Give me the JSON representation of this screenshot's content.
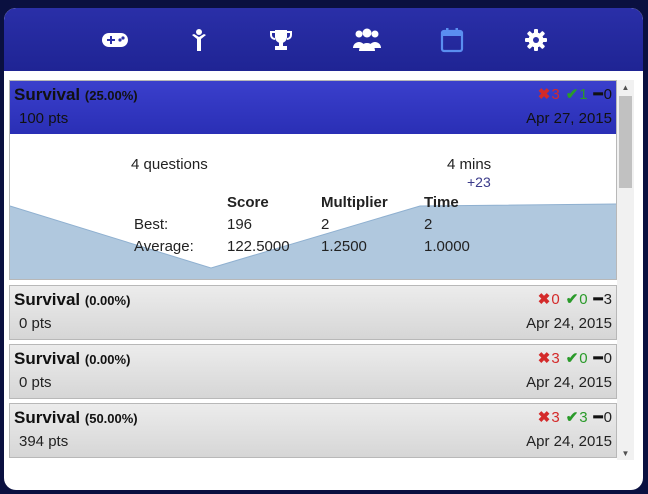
{
  "nav": {
    "icons": [
      "gamepad-icon",
      "person-icon",
      "trophy-icon",
      "users-icon",
      "calendar-icon",
      "gear-icon"
    ],
    "active_index": 4
  },
  "games": [
    {
      "mode": "Survival",
      "percent": "(25.00%)",
      "points": "100 pts",
      "wrong": "3",
      "right": "1",
      "skipped": "0",
      "date": "Apr 27, 2015",
      "expanded": true,
      "detail": {
        "questions": "4 questions",
        "time": "4 mins",
        "time_delta": "+23",
        "columns": [
          "Score",
          "Multiplier",
          "Time"
        ],
        "rows": [
          {
            "label": "Best:",
            "values": [
              "196",
              "2",
              "2"
            ]
          },
          {
            "label": "Average:",
            "values": [
              "122.5000",
              "1.2500",
              "1.0000"
            ]
          }
        ]
      }
    },
    {
      "mode": "Survival",
      "percent": "(0.00%)",
      "points": "0 pts",
      "wrong": "0",
      "right": "0",
      "skipped": "3",
      "date": "Apr 24, 2015",
      "expanded": false
    },
    {
      "mode": "Survival",
      "percent": "(0.00%)",
      "points": "0 pts",
      "wrong": "3",
      "right": "0",
      "skipped": "0",
      "date": "Apr 24, 2015",
      "expanded": false
    },
    {
      "mode": "Survival",
      "percent": "(50.00%)",
      "points": "394 pts",
      "wrong": "3",
      "right": "3",
      "skipped": "0",
      "date": "Apr 24, 2015",
      "expanded": false
    }
  ],
  "colors": {
    "topbar": "#2a2fa8",
    "active_item": "#3a3fcc",
    "wrong": "#d42a2a",
    "right": "#2a9a2a",
    "chart_fill": "#b0c8de"
  }
}
